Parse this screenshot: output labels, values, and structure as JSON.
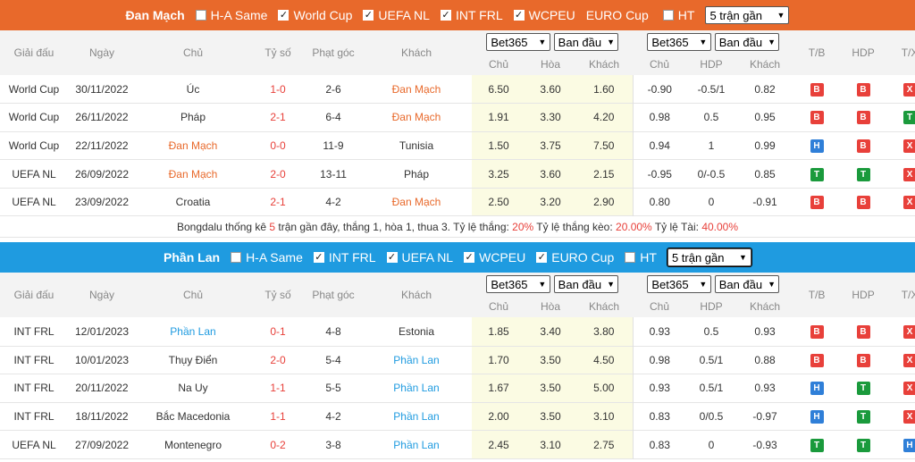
{
  "sections": [
    {
      "team": "Đan Mạch",
      "options": [
        {
          "label": "H-A Same",
          "checked": false
        },
        {
          "label": "World Cup",
          "checked": true
        },
        {
          "label": "UEFA NL",
          "checked": true
        },
        {
          "label": "INT FRL",
          "checked": true
        },
        {
          "label": "WCPEU",
          "checked": true
        },
        {
          "label": "EURO Cup",
          "checked": false
        },
        {
          "label": "HT",
          "checked": false
        }
      ],
      "range_select": "5 trận gần",
      "headers": {
        "league": "Giải đấu",
        "date": "Ngày",
        "home": "Chủ",
        "score": "Tỷ số",
        "corner": "Phạt góc",
        "away": "Khách",
        "bookmaker1": "Bet365",
        "kind1": "Ban đầu",
        "bookmaker2": "Bet365",
        "kind2": "Ban đầu",
        "o_home": "Chủ",
        "o_draw": "Hòa",
        "o_away": "Khách",
        "a_home": "Chủ",
        "a_hdp": "HDP",
        "a_away": "Khách",
        "tb": "T/B",
        "hdp": "HDP",
        "tx": "T/X"
      },
      "rows": [
        {
          "league": "World Cup",
          "date": "30/11/2022",
          "home": "Úc",
          "home_hl": false,
          "score": "1-0",
          "corner": "2-6",
          "away": "Đan Mạch",
          "away_hl": true,
          "o1": "6.50",
          "o2": "3.60",
          "o3": "1.60",
          "a1": "-0.90",
          "a2": "-0.5/1",
          "a3": "0.82",
          "tb": "B",
          "hdp": "B",
          "tx": "X"
        },
        {
          "league": "World Cup",
          "date": "26/11/2022",
          "home": "Pháp",
          "home_hl": false,
          "score": "2-1",
          "corner": "6-4",
          "away": "Đan Mạch",
          "away_hl": true,
          "o1": "1.91",
          "o2": "3.30",
          "o3": "4.20",
          "a1": "0.98",
          "a2": "0.5",
          "a3": "0.95",
          "tb": "B",
          "hdp": "B",
          "tx": "T"
        },
        {
          "league": "World Cup",
          "date": "22/11/2022",
          "home": "Đan Mạch",
          "home_hl": true,
          "score": "0-0",
          "corner": "11-9",
          "away": "Tunisia",
          "away_hl": false,
          "o1": "1.50",
          "o2": "3.75",
          "o3": "7.50",
          "a1": "0.94",
          "a2": "1",
          "a3": "0.99",
          "tb": "H",
          "hdp": "B",
          "tx": "X"
        },
        {
          "league": "UEFA NL",
          "date": "26/09/2022",
          "home": "Đan Mạch",
          "home_hl": true,
          "score": "2-0",
          "corner": "13-11",
          "away": "Pháp",
          "away_hl": false,
          "o1": "3.25",
          "o2": "3.60",
          "o3": "2.15",
          "a1": "-0.95",
          "a2": "0/-0.5",
          "a3": "0.85",
          "tb": "T",
          "hdp": "T",
          "tx": "X"
        },
        {
          "league": "UEFA NL",
          "date": "23/09/2022",
          "home": "Croatia",
          "home_hl": false,
          "score": "2-1",
          "corner": "4-2",
          "away": "Đan Mạch",
          "away_hl": true,
          "o1": "2.50",
          "o2": "3.20",
          "o3": "2.90",
          "a1": "0.80",
          "a2": "0",
          "a3": "-0.91",
          "tb": "B",
          "hdp": "B",
          "tx": "X"
        }
      ],
      "summary": {
        "p1": "Bongdalu thống kê ",
        "n": "5",
        "p2": " trận gần đây, thắng 1, hòa 1, thua 3. Tỷ lệ thắng: ",
        "win": "20%",
        "p3": " Tỷ lệ thắng kèo: ",
        "winhdp": "20.00%",
        "p4": " Tỷ lệ Tài: ",
        "over": "40.00%"
      }
    },
    {
      "team": "Phần Lan",
      "options": [
        {
          "label": "H-A Same",
          "checked": false
        },
        {
          "label": "INT FRL",
          "checked": true
        },
        {
          "label": "UEFA NL",
          "checked": true
        },
        {
          "label": "WCPEU",
          "checked": true
        },
        {
          "label": "EURO Cup",
          "checked": true
        },
        {
          "label": "HT",
          "checked": false
        }
      ],
      "range_select": "5 trận gần",
      "headers": {
        "league": "Giải đấu",
        "date": "Ngày",
        "home": "Chủ",
        "score": "Tỷ số",
        "corner": "Phạt góc",
        "away": "Khách",
        "bookmaker1": "Bet365",
        "kind1": "Ban đầu",
        "bookmaker2": "Bet365",
        "kind2": "Ban đầu",
        "o_home": "Chủ",
        "o_draw": "Hòa",
        "o_away": "Khách",
        "a_home": "Chủ",
        "a_hdp": "HDP",
        "a_away": "Khách",
        "tb": "T/B",
        "hdp": "HDP",
        "tx": "T/X"
      },
      "rows": [
        {
          "league": "INT FRL",
          "date": "12/01/2023",
          "home": "Phần Lan",
          "home_hl": true,
          "score": "0-1",
          "corner": "4-8",
          "away": "Estonia",
          "away_hl": false,
          "o1": "1.85",
          "o2": "3.40",
          "o3": "3.80",
          "a1": "0.93",
          "a2": "0.5",
          "a3": "0.93",
          "tb": "B",
          "hdp": "B",
          "tx": "X"
        },
        {
          "league": "INT FRL",
          "date": "10/01/2023",
          "home": "Thụy Điển",
          "home_hl": false,
          "score": "2-0",
          "corner": "5-4",
          "away": "Phần Lan",
          "away_hl": true,
          "o1": "1.70",
          "o2": "3.50",
          "o3": "4.50",
          "a1": "0.98",
          "a2": "0.5/1",
          "a3": "0.88",
          "tb": "B",
          "hdp": "B",
          "tx": "X"
        },
        {
          "league": "INT FRL",
          "date": "20/11/2022",
          "home": "Na Uy",
          "home_hl": false,
          "score": "1-1",
          "corner": "5-5",
          "away": "Phần Lan",
          "away_hl": true,
          "o1": "1.67",
          "o2": "3.50",
          "o3": "5.00",
          "a1": "0.93",
          "a2": "0.5/1",
          "a3": "0.93",
          "tb": "H",
          "hdp": "T",
          "tx": "X"
        },
        {
          "league": "INT FRL",
          "date": "18/11/2022",
          "home": "Bắc Macedonia",
          "home_hl": false,
          "score": "1-1",
          "corner": "4-2",
          "away": "Phần Lan",
          "away_hl": true,
          "o1": "2.00",
          "o2": "3.50",
          "o3": "3.10",
          "a1": "0.83",
          "a2": "0/0.5",
          "a3": "-0.97",
          "tb": "H",
          "hdp": "T",
          "tx": "X"
        },
        {
          "league": "UEFA NL",
          "date": "27/09/2022",
          "home": "Montenegro",
          "home_hl": false,
          "score": "0-2",
          "corner": "3-8",
          "away": "Phần Lan",
          "away_hl": true,
          "o1": "2.45",
          "o2": "3.10",
          "o3": "2.75",
          "a1": "0.83",
          "a2": "0",
          "a3": "-0.93",
          "tb": "T",
          "hdp": "T",
          "tx": "H"
        }
      ]
    }
  ]
}
